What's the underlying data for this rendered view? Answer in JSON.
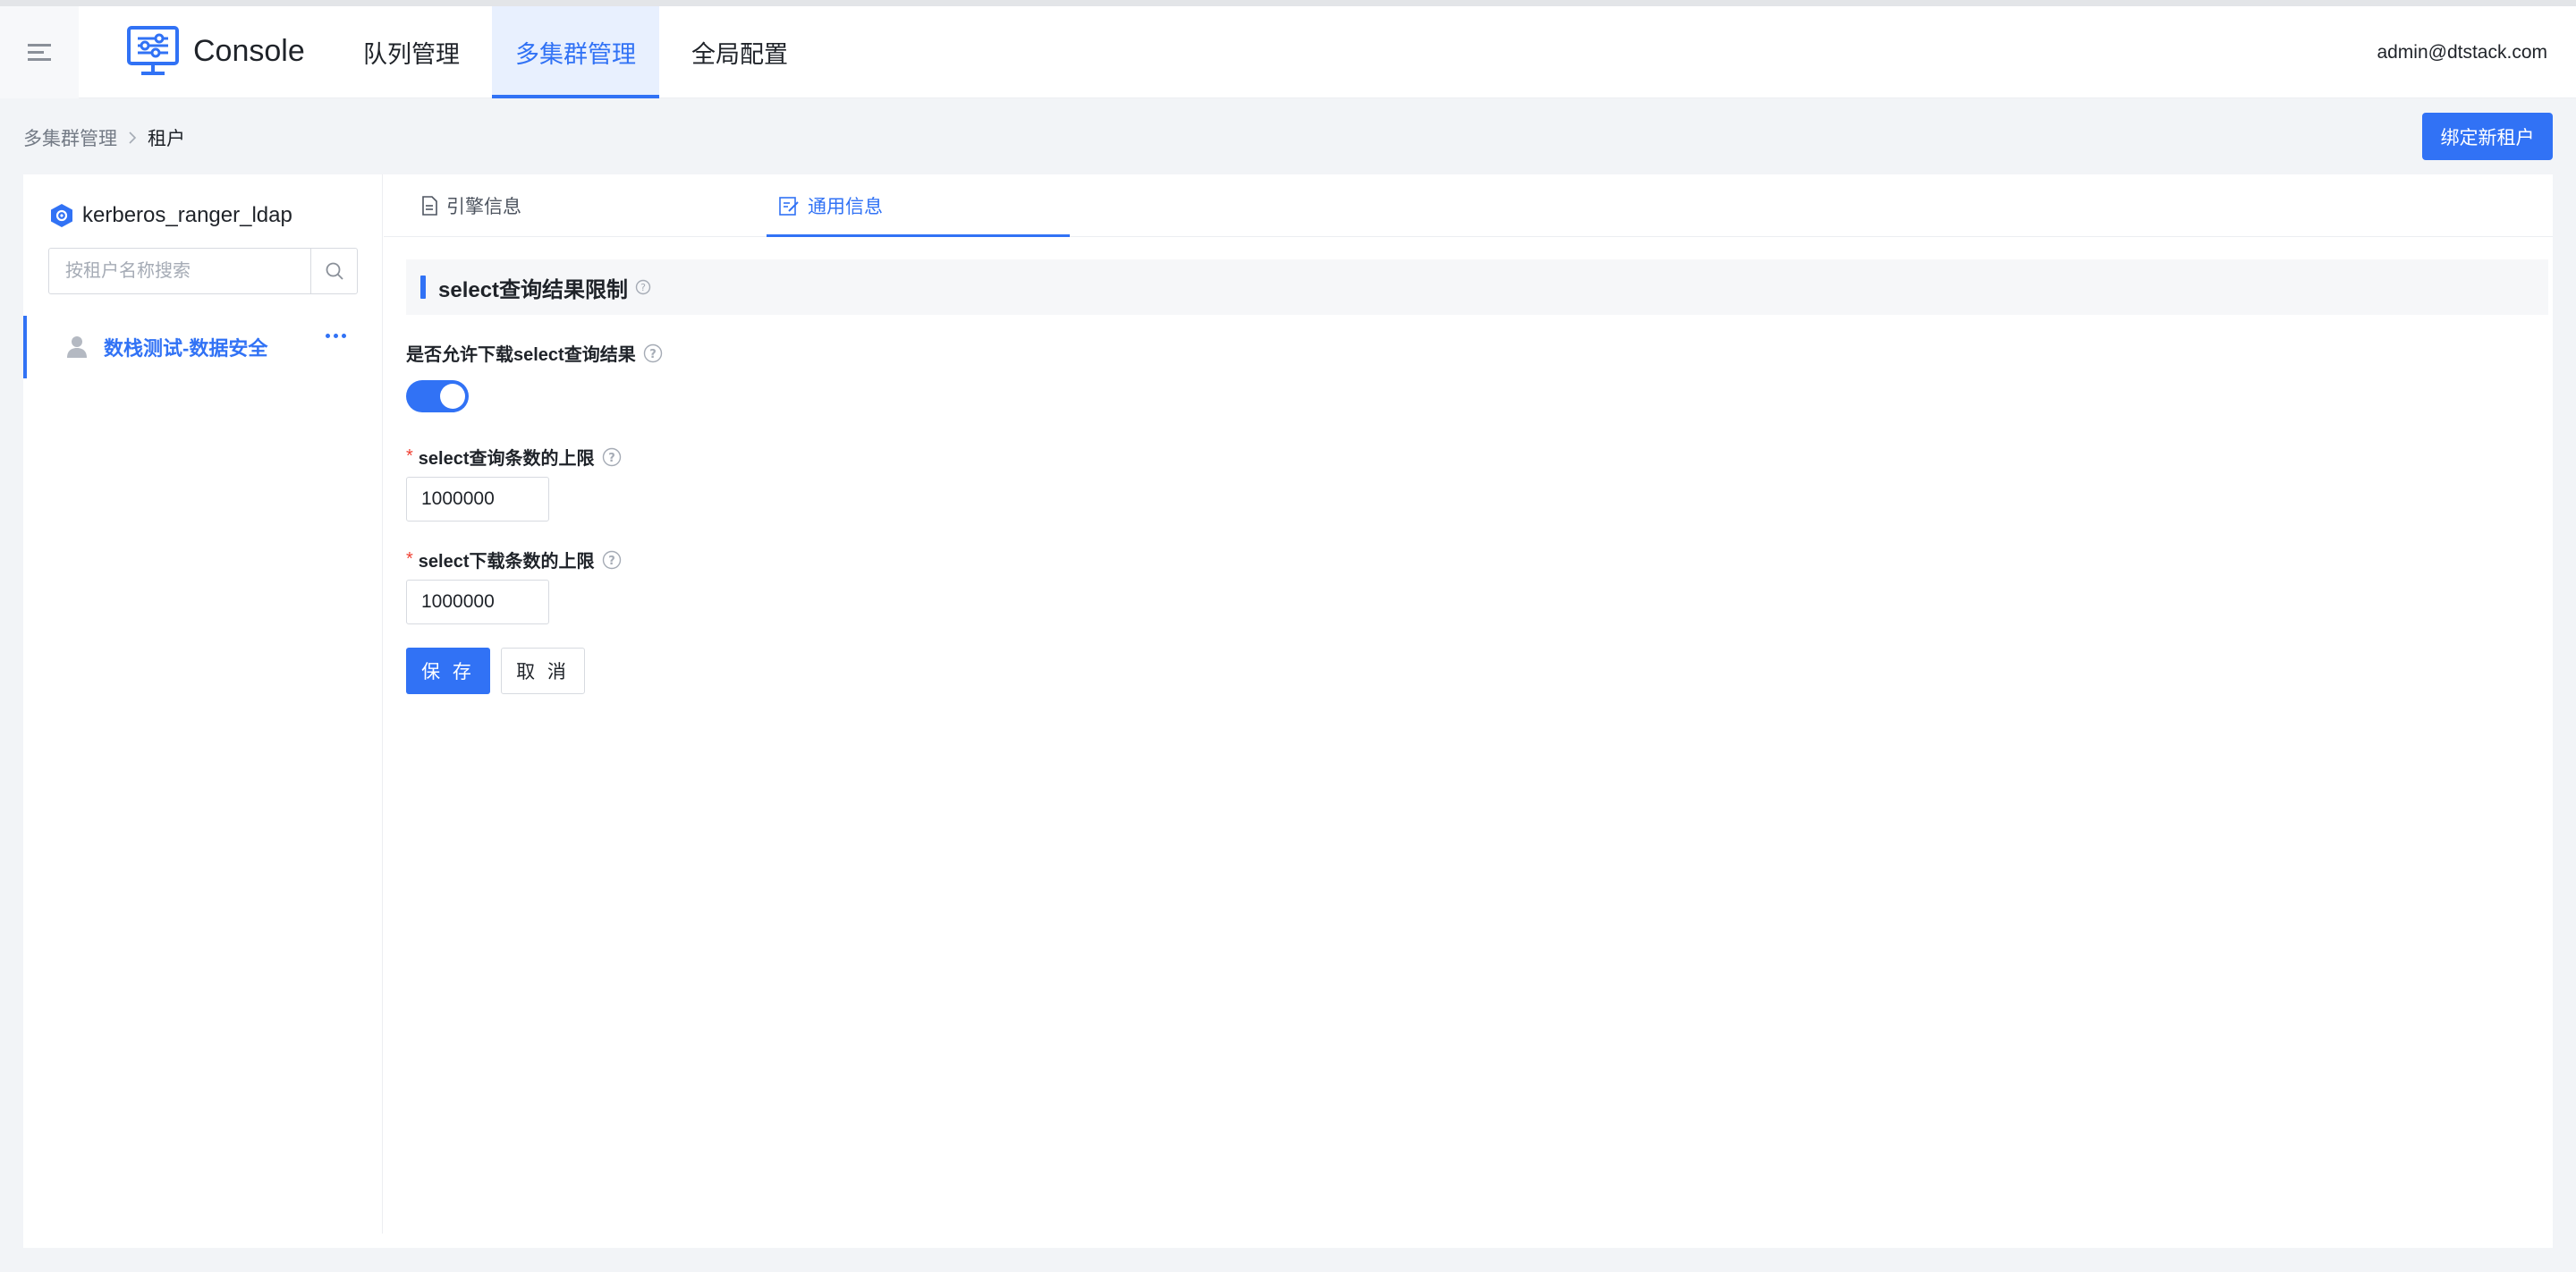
{
  "app": {
    "title": "Console"
  },
  "nav": {
    "items": [
      "队列管理",
      "多集群管理",
      "全局配置"
    ],
    "active": "多集群管理"
  },
  "user": {
    "email": "admin@dtstack.com"
  },
  "breadcrumb": {
    "root": "多集群管理",
    "current": "租户"
  },
  "actions": {
    "bind_tenant": "绑定新租户"
  },
  "sidebar": {
    "cluster_name": "kerberos_ranger_ldap",
    "search_placeholder": "按租户名称搜索",
    "tenants": [
      {
        "name": "数栈测试-数据安全",
        "selected": true
      }
    ]
  },
  "tabs": {
    "engine_info": "引擎信息",
    "general_info": "通用信息",
    "active": "通用信息"
  },
  "form": {
    "section_title": "select查询结果限制",
    "allow_download_label": "是否允许下载select查询结果",
    "allow_download": true,
    "query_limit_label": "select查询条数的上限",
    "query_limit": "1000000",
    "download_limit_label": "select下载条数的上限",
    "download_limit": "1000000",
    "save": "保 存",
    "cancel": "取 消"
  },
  "colors": {
    "accent": "#3172f5",
    "required": "#f04134"
  },
  "icons": [
    "menu-icon",
    "console-logo-icon",
    "cluster-icon",
    "search-icon",
    "user-icon",
    "more-icon",
    "file-icon",
    "edit-icon",
    "help-icon",
    "chevron-right-icon"
  ]
}
